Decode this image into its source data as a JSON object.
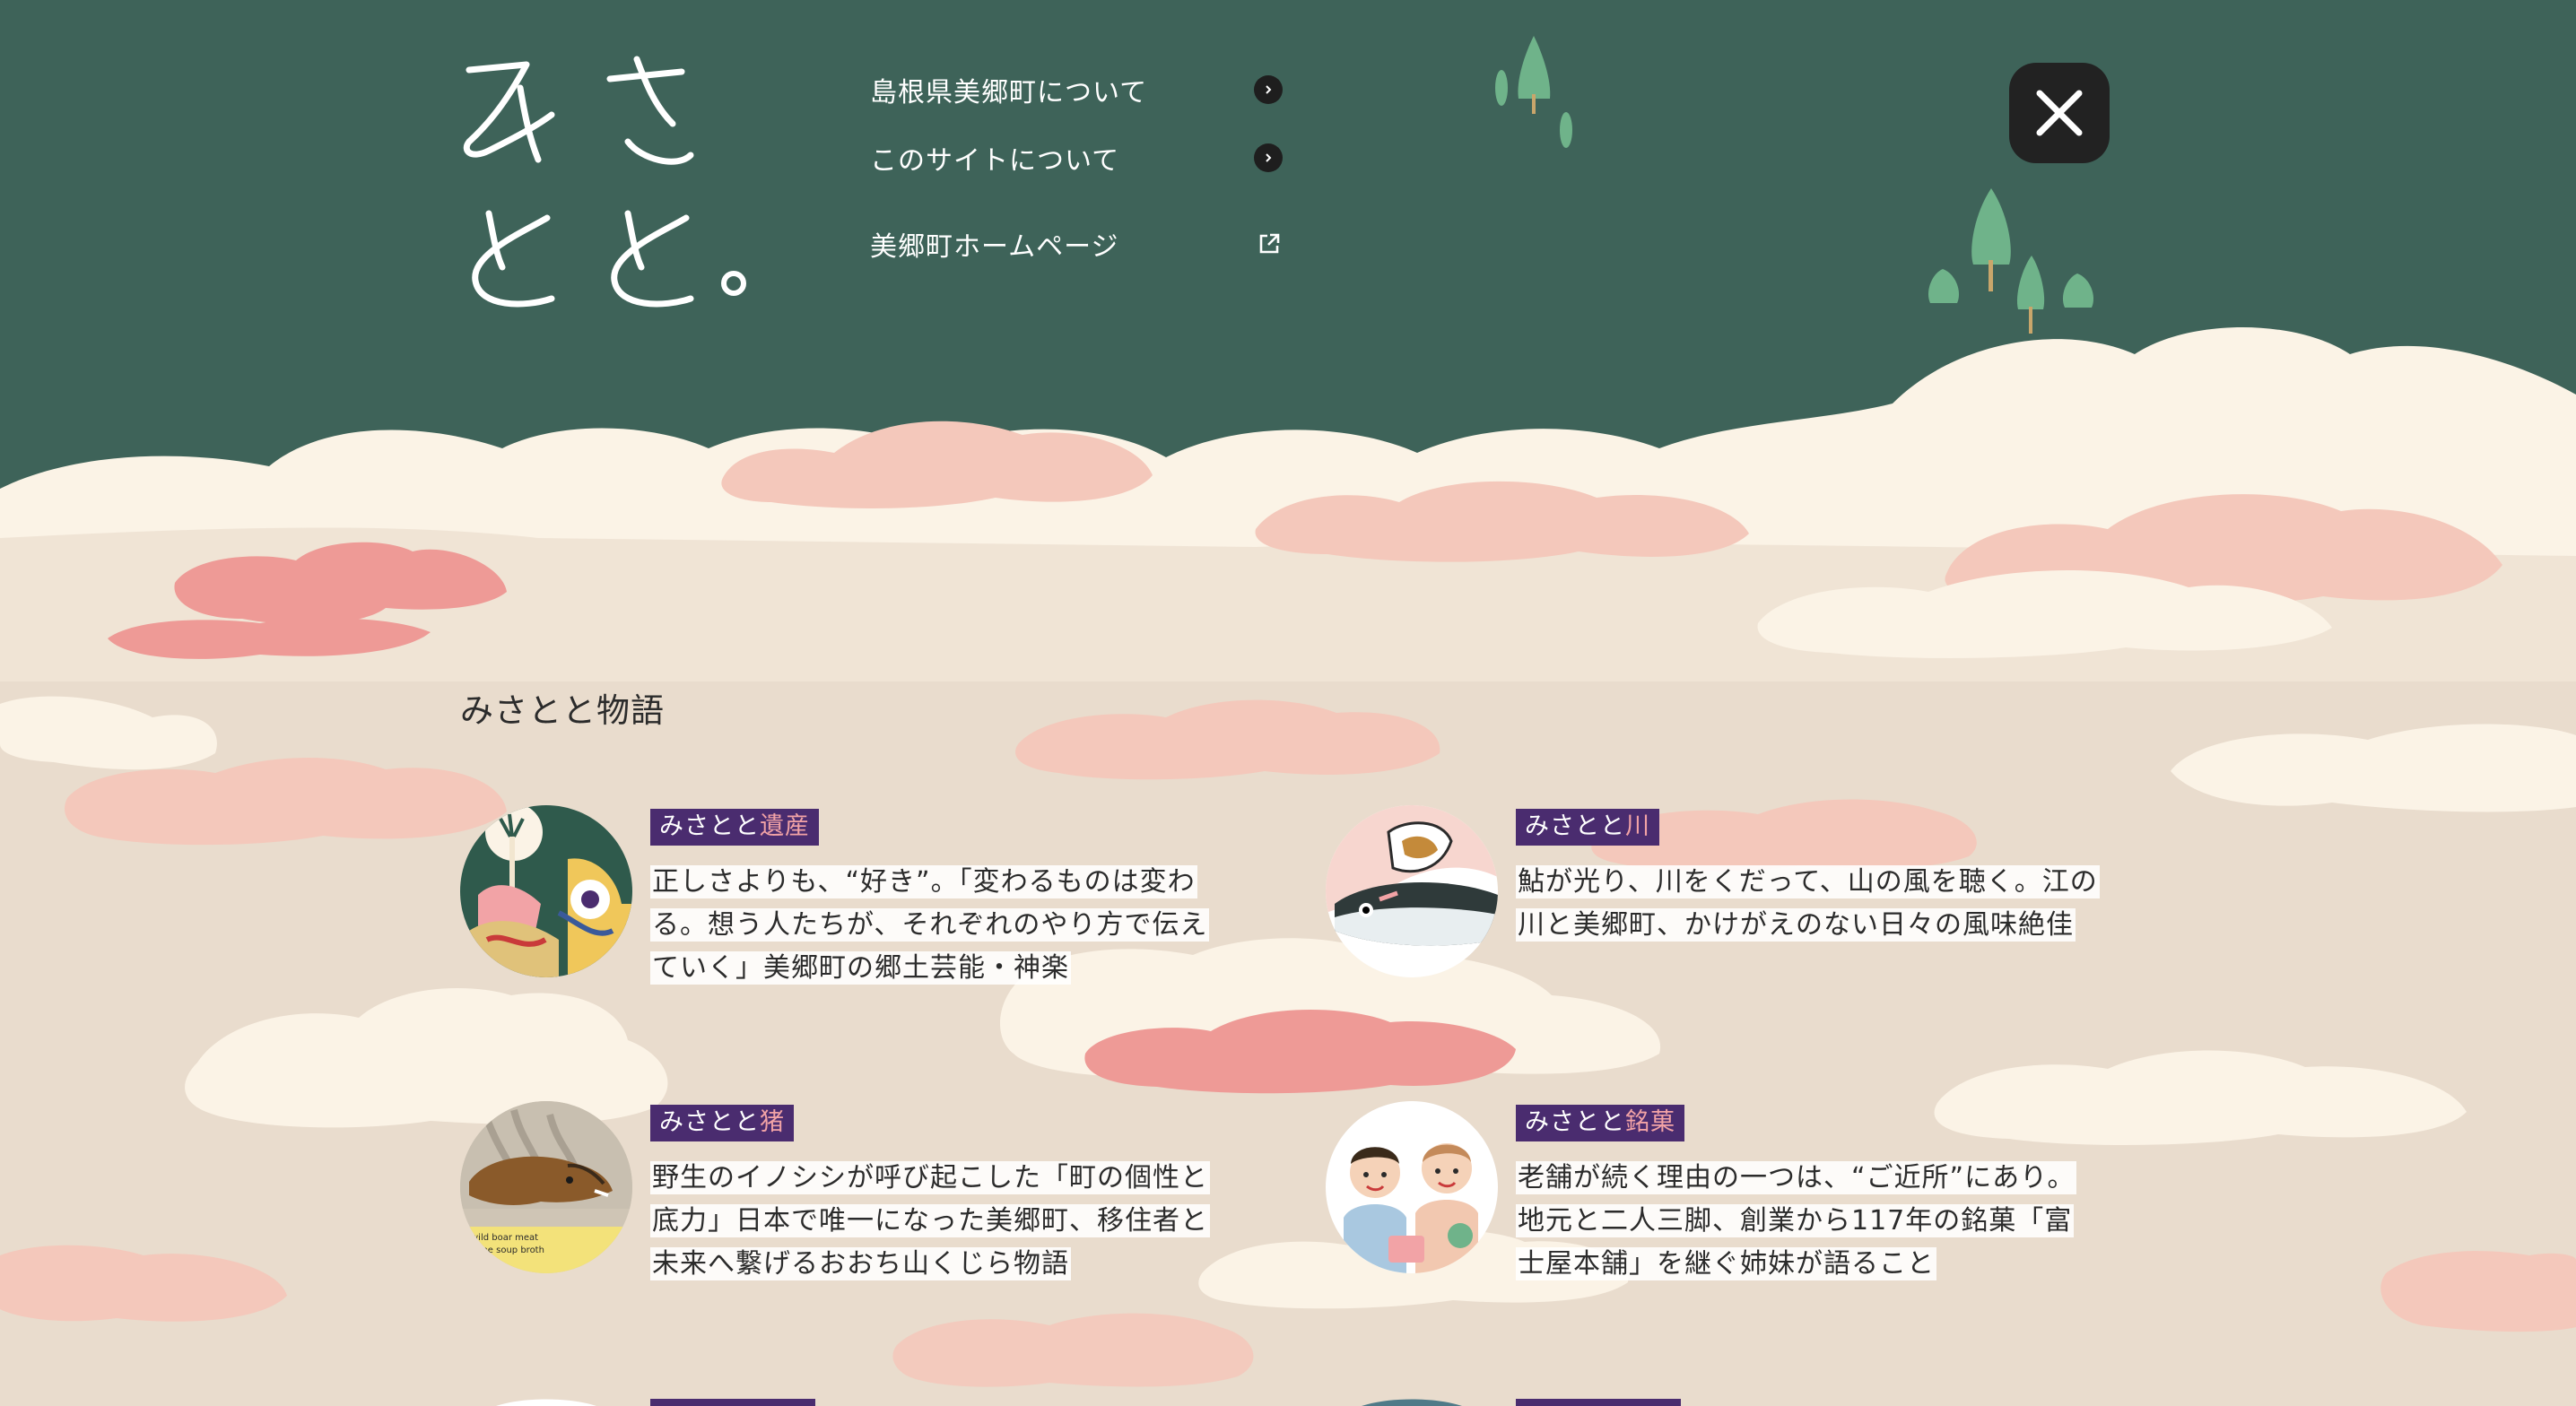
{
  "logo": {
    "alt": "みさとと。"
  },
  "nav": {
    "items": [
      {
        "label": "島根県美郷町について",
        "icon": "chevron-right-icon"
      },
      {
        "label": "このサイトについて",
        "icon": "chevron-right-icon"
      },
      {
        "label": "美郷町ホームページ",
        "icon": "external-link-icon"
      }
    ]
  },
  "close": {
    "icon": "close-icon"
  },
  "section": {
    "title": "みさとと物語"
  },
  "stories": [
    {
      "tag_prefix": "みさとと",
      "tag_accent": "遺産",
      "text": "正しさよりも、“好き”。「変わるものは変わる。想う人たちが、それぞれのやり方で伝えていく」美郷町の郷土芸能・神楽"
    },
    {
      "tag_prefix": "みさとと",
      "tag_accent": "川",
      "text": "鮎が光り、川をくだって、山の風を聴く。江の川と美郷町、かけがえのない日々の風味絶佳"
    },
    {
      "tag_prefix": "みさとと",
      "tag_accent": "猪",
      "text": "野生のイノシシが呼び起こした「町の個性と底力」日本で唯一になった美郷町、移住者と未来へ繋げるおおち山くじら物語",
      "thumb_caption_1": "wild boar meat",
      "thumb_caption_2": "bone soup broth"
    },
    {
      "tag_prefix": "みさとと",
      "tag_accent": "銘菓",
      "text": "老舗が続く理由の一つは、“ご近所”にあり。地元と二人三脚、創業から117年の銘菓「富士屋本舗」を継ぐ姉妹が語ること"
    }
  ],
  "colors": {
    "header_bg": "#3e6359",
    "ground": "#e9dccd",
    "cloud_cream": "#fbf3e6",
    "cloud_peach": "#f4c8bb",
    "cloud_coral": "#ee9a96",
    "tag_bg": "#4a2c6f",
    "tag_accent": "#f2a3a6",
    "tree": "#6fb38a"
  }
}
